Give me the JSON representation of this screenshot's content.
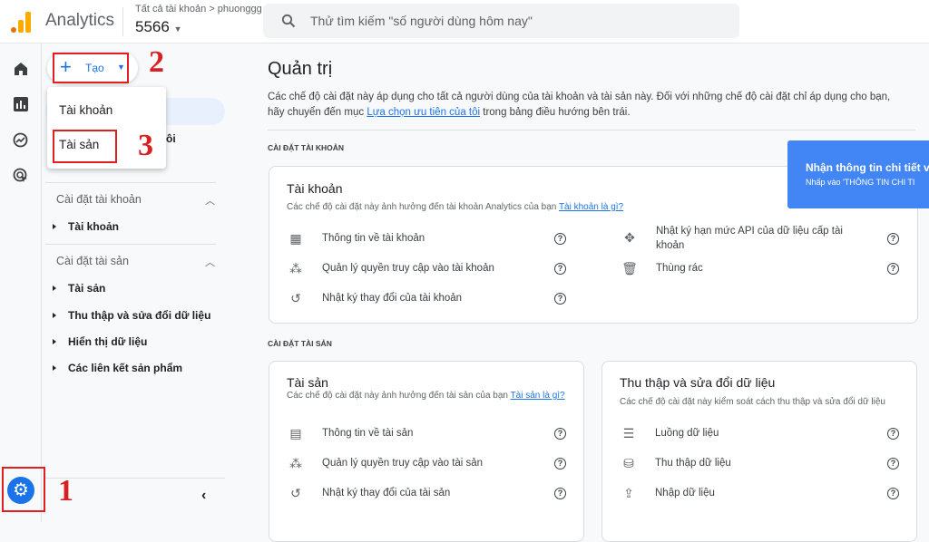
{
  "header": {
    "app_name": "Analytics",
    "breadcrumb": "Tất cả tài khoản > phuonggg",
    "property": "5566",
    "search_placeholder": "Thử tìm kiếm \"số người dùng hôm nay\""
  },
  "create": {
    "label": "Tạo",
    "menu": [
      "Tài khoản",
      "Tài sản"
    ]
  },
  "annotations": [
    "1",
    "2",
    "3"
  ],
  "sidebar": {
    "hidden_item_fragment": "ôi",
    "sections": [
      {
        "title": "Cài đặt tài khoản",
        "items": [
          "Tài khoản"
        ]
      },
      {
        "title": "Cài đặt tài sản",
        "items": [
          "Tài sản",
          "Thu thập và sửa đổi dữ liệu",
          "Hiển thị dữ liệu",
          "Các liên kết sản phẩm"
        ]
      }
    ]
  },
  "main": {
    "title": "Quản trị",
    "intro_pre": "Các chế độ cài đặt này áp dụng cho tất cả người dùng của tài khoản và tài sản này. Đối với những chế độ cài đặt chỉ áp dụng cho bạn, hãy chuyển đến mục ",
    "intro_link": "Lựa chọn ưu tiên của tôi",
    "intro_post": " trong bảng điều hướng bên trái.",
    "account_caption": "CÀI ĐẶT TÀI KHOẢN",
    "property_caption": "CÀI ĐẶT TÀI SẢN",
    "account_card": {
      "title": "Tài khoản",
      "desc": "Các chế độ cài đặt này ảnh hưởng đến tài khoản Analytics của bạn ",
      "link": "Tài khoản là gì?",
      "left": [
        "Thông tin về tài khoản",
        "Quản lý quyền truy cập vào tài khoản",
        "Nhật ký thay đổi của tài khoản"
      ],
      "right": [
        "Nhật ký hạn mức API của dữ liệu cấp tài khoản",
        "Thùng rác"
      ]
    },
    "property_card": {
      "title": "Tài sản",
      "desc": "Các chế độ cài đặt này ảnh hưởng đến tài sản của bạn ",
      "link": "Tài sản là gì?",
      "items": [
        "Thông tin về tài sản",
        "Quản lý quyền truy cập vào tài sản",
        "Nhật ký thay đổi của tài sản"
      ]
    },
    "data_card": {
      "title": "Thu thập và sửa đổi dữ liệu",
      "desc": "Các chế độ cài đặt này kiểm soát cách thu thập và sửa đổi dữ liệu",
      "items": [
        "Luồng dữ liệu",
        "Thu thập dữ liệu",
        "Nhập dữ liệu"
      ]
    }
  },
  "tooltip": {
    "title": "Nhận thông tin chi tiết v",
    "subtitle": "Nhấp vào 'THÔNG TIN CHI TI"
  },
  "colors": {
    "accent": "#1a73e8",
    "tooltip": "#4285f4",
    "annotation": "#d91f1f"
  }
}
